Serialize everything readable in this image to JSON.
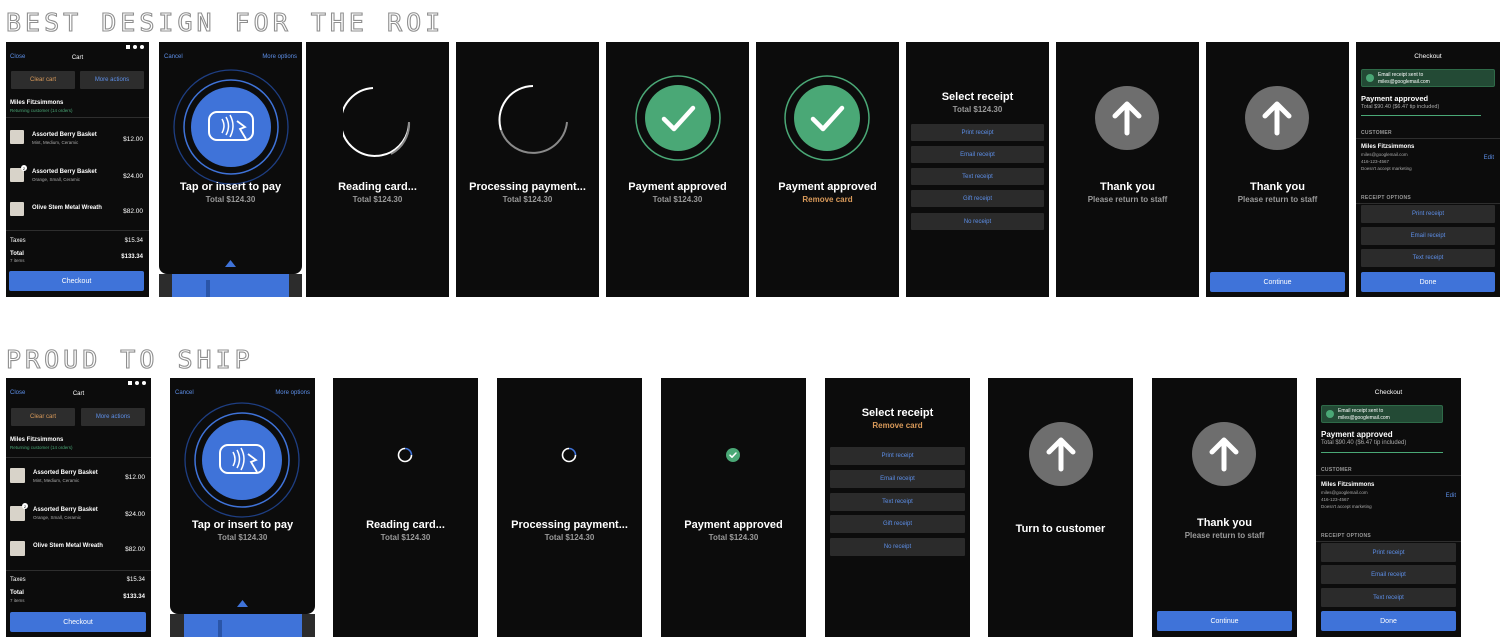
{
  "rows": [
    {
      "title": "BEST DESIGN FOR THE ROI"
    },
    {
      "title": "PROUD TO SHIP"
    }
  ],
  "common": {
    "close": "Close",
    "cart": "Cart",
    "clear_cart": "Clear cart",
    "more_actions": "More actions",
    "customer_name": "Miles Fitzsimmons",
    "customer_sub": "Returning customer (14 orders)",
    "items": [
      {
        "name": "Assorted Berry Basket",
        "options": "Mint, Medium, Ceramic",
        "price": "$12.00",
        "qty": ""
      },
      {
        "name": "Assorted Berry Basket",
        "options": "Orange, Small, Ceramic",
        "price": "$24.00",
        "qty": "2"
      },
      {
        "name": "Olive Stem Metal Wreath",
        "options": "",
        "price": "$82.00",
        "qty": ""
      }
    ],
    "taxes_label": "Taxes",
    "taxes_value": "$15.34",
    "total_label": "Total",
    "total_sub": "7 items",
    "total_value": "$133.34",
    "checkout": "Checkout",
    "cancel": "Cancel",
    "more_options": "More options",
    "tap_title": "Tap or insert to pay",
    "total_line": "Total $124.30",
    "reading_title": "Reading card...",
    "processing_title": "Processing payment...",
    "approved_title": "Payment approved",
    "remove_card": "Remove card",
    "select_receipt": "Select receipt",
    "receipt_buttons": [
      "Print receipt",
      "Email receipt",
      "Text receipt",
      "Gift receipt",
      "No receipt"
    ],
    "thank_you": "Thank you",
    "return_staff": "Please return to staff",
    "turn_customer": "Turn to customer",
    "continue": "Continue",
    "checkout_title": "Checkout",
    "banner_line1": "Email receipt sent to",
    "banner_line2": "miles@googlemail.com",
    "summary_total": "Total $90.40 ($6.47 tip included)",
    "customer_label": "CUSTOMER",
    "customer_email": "miles@googlemail.com",
    "customer_phone": "416-123-4567",
    "customer_marketing": "Doesn't accept marketing",
    "edit": "Edit",
    "receipt_options_label": "RECEIPT OPTIONS",
    "final_receipt_buttons": [
      "Print receipt",
      "Email receipt",
      "Text receipt"
    ],
    "done": "Done"
  },
  "colors": {
    "screen_bg": "#0c0c0c",
    "accent_blue": "#3f73d9",
    "link_blue": "#5d8fe8",
    "success_green": "#4aa876",
    "warning_orange": "#d99a5a",
    "neutral_circle": "#6e6e6e"
  },
  "icons": [
    "contactless-card-icon",
    "loading-spinner-icon",
    "checkmark-icon",
    "arrow-up-icon",
    "caret-up-icon",
    "check-circle-icon"
  ]
}
